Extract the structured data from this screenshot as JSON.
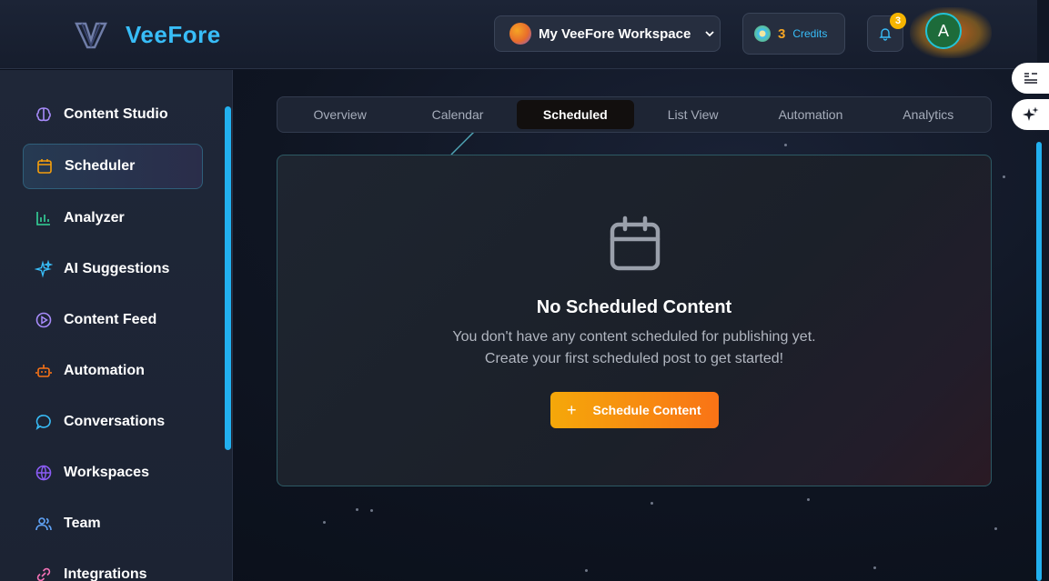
{
  "app": {
    "name": "VeeFore"
  },
  "header": {
    "workspace_label": "My VeeFore Workspace",
    "credits_count": "3",
    "credits_label": "Credits",
    "notification_count": "3",
    "avatar_initial": "A"
  },
  "sidebar": {
    "items": [
      {
        "label": "Content Studio",
        "icon": "brain-icon",
        "color": "#a78bfa",
        "active": false
      },
      {
        "label": "Scheduler",
        "icon": "calendar-icon",
        "color": "#f59e0b",
        "active": true
      },
      {
        "label": "Analyzer",
        "icon": "bar-chart-icon",
        "color": "#34d399",
        "active": false
      },
      {
        "label": "AI Suggestions",
        "icon": "sparkles-icon",
        "color": "#38bdf8",
        "active": false
      },
      {
        "label": "Content Feed",
        "icon": "play-circle-icon",
        "color": "#a78bfa",
        "active": false
      },
      {
        "label": "Automation",
        "icon": "robot-icon",
        "color": "#f97316",
        "active": false
      },
      {
        "label": "Conversations",
        "icon": "chat-bubble-icon",
        "color": "#38bdf8",
        "active": false
      },
      {
        "label": "Workspaces",
        "icon": "globe-icon",
        "color": "#8b5cf6",
        "active": false
      },
      {
        "label": "Team",
        "icon": "users-icon",
        "color": "#60a5fa",
        "active": false
      },
      {
        "label": "Integrations",
        "icon": "link-icon",
        "color": "#f472b6",
        "active": false
      }
    ]
  },
  "tabs": [
    "Overview",
    "Calendar",
    "Scheduled",
    "List View",
    "Automation",
    "Analytics"
  ],
  "active_tab": "Scheduled",
  "empty_state": {
    "title": "No Scheduled Content",
    "line1": "You don't have any content scheduled for publishing yet.",
    "line2": "Create your first scheduled post to get started!",
    "cta_label": "Schedule Content",
    "cta_icon": "+"
  },
  "colors": {
    "accent": "#38bdf8",
    "cta_start": "#f5a80a",
    "cta_end": "#f97316"
  }
}
